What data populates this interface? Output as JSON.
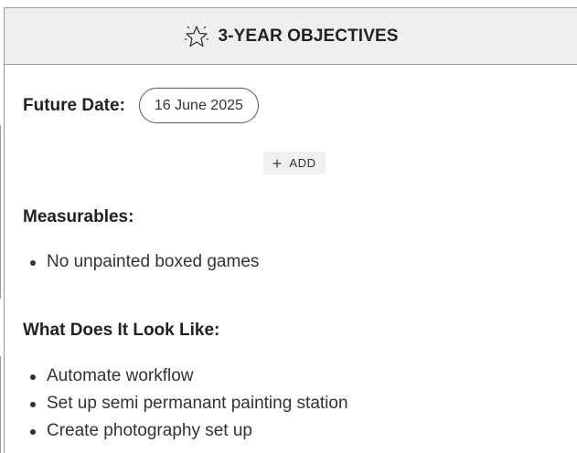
{
  "header": {
    "title": "3-YEAR OBJECTIVES",
    "icon": "star-icon"
  },
  "future_date": {
    "label": "Future Date:",
    "value": "16 June 2025"
  },
  "add_button": {
    "icon": "plus-icon",
    "label": "ADD"
  },
  "measurables": {
    "title": "Measurables:",
    "items": [
      "No unpainted boxed games"
    ]
  },
  "look_like": {
    "title": "What Does It Look Like:",
    "items": [
      "Automate workflow",
      "Set up semi permanant painting station",
      "Create photography set up"
    ]
  }
}
